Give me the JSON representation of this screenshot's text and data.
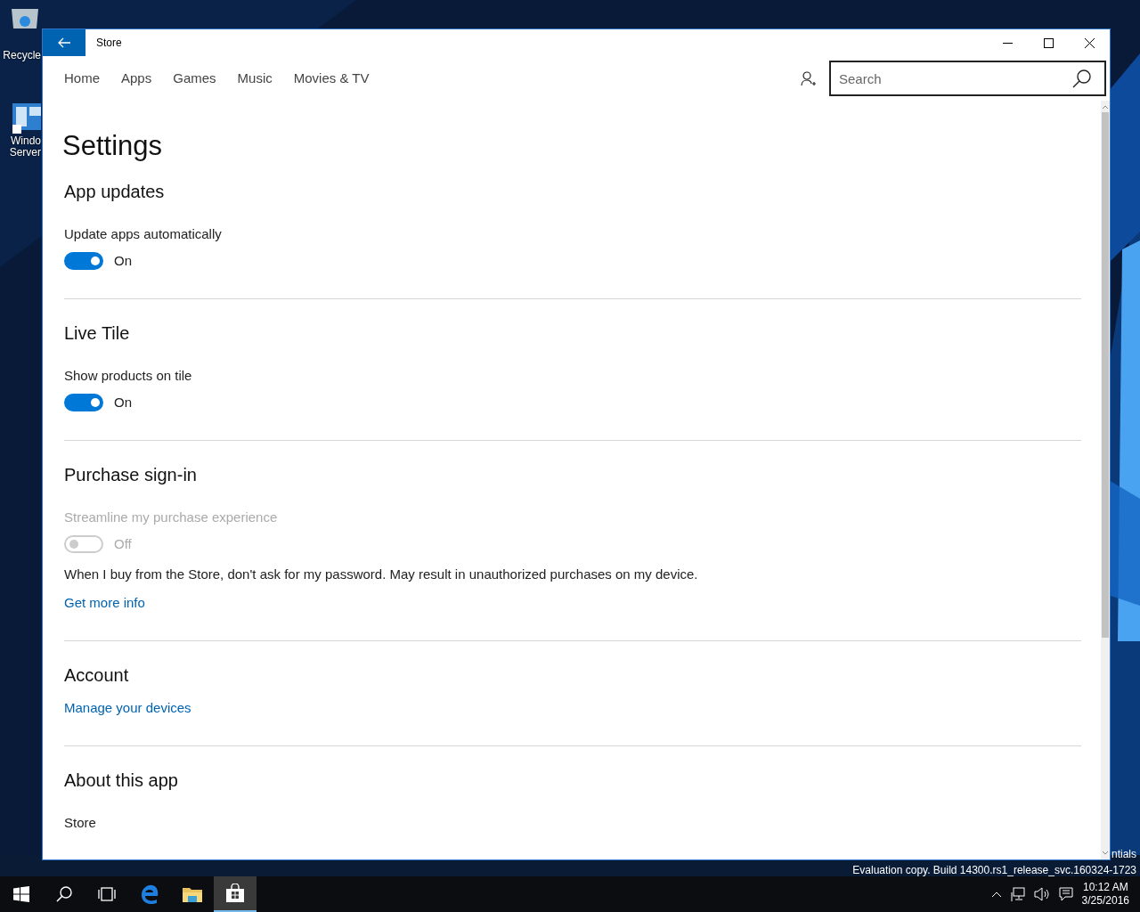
{
  "desktop": {
    "icons": [
      {
        "kind": "recycle",
        "lines": [
          "Recycle"
        ]
      },
      {
        "kind": "dashboard",
        "lines": [
          "Windo",
          "Server"
        ]
      }
    ],
    "edge_text": "ntials",
    "evaluation": "Evaluation copy. Build 14300.rs1_release_svc.160324-1723"
  },
  "window": {
    "title": "Store"
  },
  "nav": [
    {
      "label": "Home"
    },
    {
      "label": "Apps"
    },
    {
      "label": "Games"
    },
    {
      "label": "Music"
    },
    {
      "label": "Movies & TV"
    }
  ],
  "search": {
    "placeholder": "Search"
  },
  "page_title": "Settings",
  "sections": [
    {
      "heading": "App updates",
      "items": [
        {
          "kind": "toggle",
          "label": "Update apps automatically",
          "on": true,
          "disabled": false,
          "state_text": "On"
        }
      ]
    },
    {
      "heading": "Live Tile",
      "items": [
        {
          "kind": "toggle",
          "label": "Show products on tile",
          "on": true,
          "disabled": false,
          "state_text": "On"
        }
      ]
    },
    {
      "heading": "Purchase sign-in",
      "items": [
        {
          "kind": "toggle",
          "label": "Streamline my purchase experience",
          "on": false,
          "disabled": true,
          "state_text": "Off"
        },
        {
          "kind": "text",
          "text": "When I buy from the Store, don't ask for my password. May result in unauthorized purchases on my device."
        },
        {
          "kind": "link",
          "text": "Get more info"
        }
      ]
    },
    {
      "heading": "Account",
      "items": [
        {
          "kind": "link",
          "text": "Manage your devices"
        }
      ]
    },
    {
      "heading": "About this app",
      "items": [
        {
          "kind": "text",
          "text": "Store"
        }
      ]
    }
  ],
  "taskbar": {
    "items": [
      {
        "kind": "start",
        "selected": false
      },
      {
        "kind": "search",
        "selected": false
      },
      {
        "kind": "taskview",
        "selected": false
      },
      {
        "kind": "edge",
        "selected": false
      },
      {
        "kind": "explorer",
        "selected": false
      },
      {
        "kind": "store",
        "selected": true
      }
    ],
    "clock": {
      "time": "10:12 AM",
      "date": "3/25/2016"
    }
  }
}
